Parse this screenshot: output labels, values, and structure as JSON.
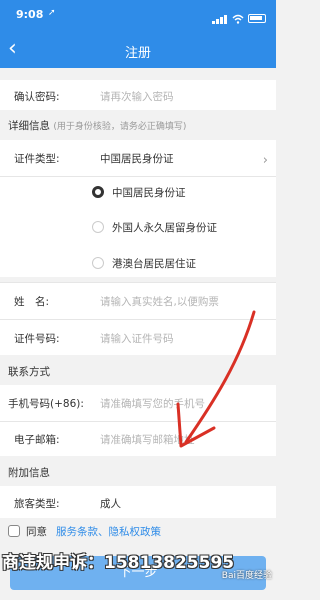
{
  "status_bar": {
    "time": "9:08",
    "location_arrow": "➚"
  },
  "nav": {
    "title": "注册",
    "back_icon": "‹"
  },
  "confirm_password": {
    "label": "确认密码:",
    "placeholder": "请再次输入密码"
  },
  "details_section": {
    "title": "详细信息",
    "note": "(用于身份核验，请务必正确填写)"
  },
  "id_type": {
    "label": "证件类型:",
    "value": "中国居民身份证",
    "options": [
      {
        "label": "中国居民身份证",
        "selected": true
      },
      {
        "label": "外国人永久居留身份证",
        "selected": false
      },
      {
        "label": "港澳台居民居住证",
        "selected": false
      }
    ]
  },
  "name": {
    "label": "姓　名:",
    "placeholder": "请输入真实姓名,以便购票"
  },
  "id_number": {
    "label": "证件号码:",
    "placeholder": "请输入证件号码"
  },
  "contact_section": {
    "title": "联系方式"
  },
  "phone": {
    "label": "手机号码(+86):",
    "placeholder": "请准确填写您的手机号"
  },
  "email": {
    "label": "电子邮箱:",
    "placeholder": "请准确填写邮箱地址"
  },
  "extra_section": {
    "title": "附加信息"
  },
  "passenger_type": {
    "label": "旅客类型:",
    "value": "成人"
  },
  "agreement": {
    "prefix": "同意",
    "links": "服务条款、隐私权政策"
  },
  "next_button": {
    "label": "下一步"
  },
  "overlay": {
    "banner": "商违规申诉：15813825595",
    "watermark": "Bai百度经验"
  },
  "colors": {
    "brand_blue": "#2f8ce8",
    "annotation_red": "#d93025"
  }
}
